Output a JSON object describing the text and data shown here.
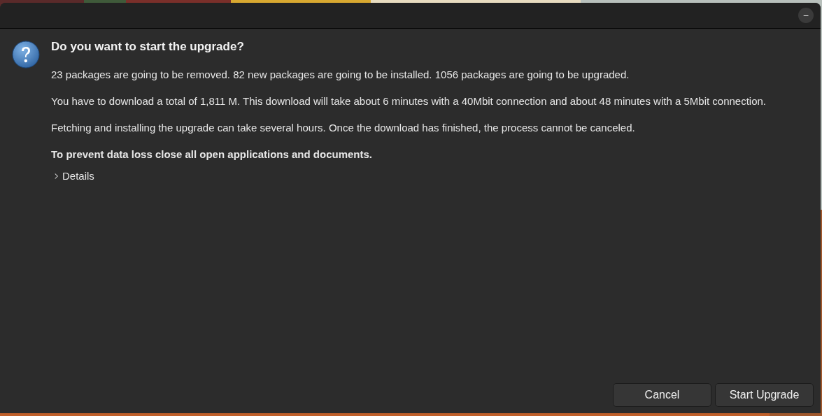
{
  "window": {
    "minimize_button": "–"
  },
  "dialog": {
    "title": "Do you want to start the upgrade?",
    "paragraphs": [
      {
        "text": "23 packages are going to be removed. 82 new packages are going to be installed. 1056 packages are going to be upgraded.",
        "bold": false
      },
      {
        "text": "You have to download a total of 1,811 M. This download will take about 6 minutes with a 40Mbit connection and about 48 minutes with a 5Mbit connection.",
        "bold": false
      },
      {
        "text": "Fetching and installing the upgrade can take several hours. Once the download has finished, the process cannot be canceled.",
        "bold": false
      },
      {
        "text": "To prevent data loss close all open applications and documents.",
        "bold": true
      }
    ],
    "details": {
      "label": "Details",
      "expanded": false
    },
    "buttons": [
      "Cancel",
      "Start Upgrade"
    ]
  }
}
